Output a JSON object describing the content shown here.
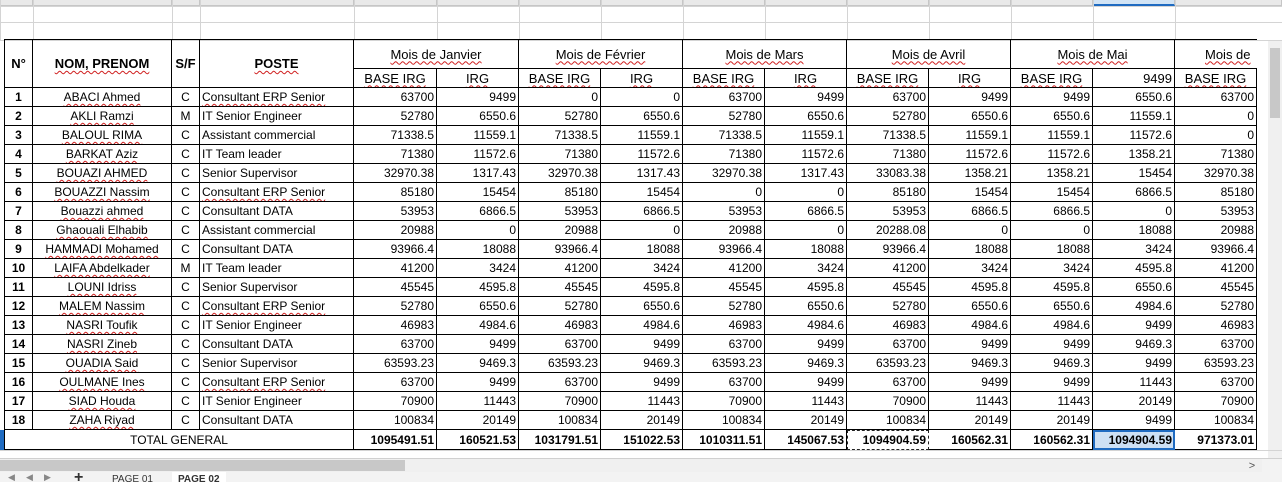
{
  "sheet": {
    "header_top": {
      "no": "N°",
      "name": "NOM, PRENOM",
      "sf": "S/F",
      "poste": "POSTE"
    },
    "months": [
      "Mois de Janvier",
      "Mois de Février",
      "Mois de Mars",
      "Mois de Avril",
      "Mois de Mai",
      "Mois de"
    ],
    "subheaders": [
      "BASE IRG",
      "IRG",
      "BASE IRG",
      "IRG",
      "BASE IRG",
      "IRG",
      "BASE IRG",
      "IRG",
      "BASE IRG",
      "9499",
      "BASE IRG"
    ],
    "rows": [
      {
        "no": "1",
        "name": "ABACI Ahmed",
        "sf": "C",
        "poste": "Consultant ERP  Senior",
        "v": [
          "63700",
          "9499",
          "0",
          "0",
          "63700",
          "9499",
          "63700",
          "9499",
          "9499",
          "6550.6",
          "63700"
        ]
      },
      {
        "no": "2",
        "name": "AKLI Ramzi",
        "sf": "M",
        "poste": "IT Senior  Engineer",
        "v": [
          "52780",
          "6550.6",
          "52780",
          "6550.6",
          "52780",
          "6550.6",
          "52780",
          "6550.6",
          "6550.6",
          "11559.1",
          "0"
        ]
      },
      {
        "no": "3",
        "name": "BALOUL RIMA",
        "sf": "C",
        "poste": "Assistant commercial",
        "v": [
          "71338.5",
          "11559.1",
          "71338.5",
          "11559.1",
          "71338.5",
          "11559.1",
          "71338.5",
          "11559.1",
          "11559.1",
          "11572.6",
          "0"
        ]
      },
      {
        "no": "4",
        "name": "BARKAT Aziz",
        "sf": "C",
        "poste": "IT Team leader",
        "v": [
          "71380",
          "11572.6",
          "71380",
          "11572.6",
          "71380",
          "11572.6",
          "71380",
          "11572.6",
          "11572.6",
          "1358.21",
          "71380"
        ]
      },
      {
        "no": "5",
        "name": "BOUAZI AHMED",
        "sf": "C",
        "poste": "Senior Supervisor",
        "v": [
          "32970.38",
          "1317.43",
          "32970.38",
          "1317.43",
          "32970.38",
          "1317.43",
          "33083.38",
          "1358.21",
          "1358.21",
          "15454",
          "32970.38"
        ]
      },
      {
        "no": "6",
        "name": "BOUAZZI Nassim",
        "sf": "C",
        "poste": "Consultant ERP  Senior",
        "v": [
          "85180",
          "15454",
          "85180",
          "15454",
          "0",
          "0",
          "85180",
          "15454",
          "15454",
          "6866.5",
          "85180"
        ]
      },
      {
        "no": "7",
        "name": "Bouazzi ahmed",
        "sf": "C",
        "poste": "Consultant DATA",
        "v": [
          "53953",
          "6866.5",
          "53953",
          "6866.5",
          "53953",
          "6866.5",
          "53953",
          "6866.5",
          "6866.5",
          "0",
          "53953"
        ]
      },
      {
        "no": "8",
        "name": "Ghaouali Elhabib",
        "sf": "C",
        "poste": "Assistant commercial",
        "v": [
          "20988",
          "0",
          "20988",
          "0",
          "20988",
          "0",
          "20288.08",
          "0",
          "0",
          "18088",
          "20988"
        ]
      },
      {
        "no": "9",
        "name": "HAMMADI Mohamed",
        "sf": "C",
        "poste": "Consultant DATA",
        "v": [
          "93966.4",
          "18088",
          "93966.4",
          "18088",
          "93966.4",
          "18088",
          "93966.4",
          "18088",
          "18088",
          "3424",
          "93966.4"
        ]
      },
      {
        "no": "10",
        "name": "LAIFA Abdelkader",
        "sf": "M",
        "poste": "IT Team leader",
        "v": [
          "41200",
          "3424",
          "41200",
          "3424",
          "41200",
          "3424",
          "41200",
          "3424",
          "3424",
          "4595.8",
          "41200"
        ]
      },
      {
        "no": "11",
        "name": "LOUNI Idriss",
        "sf": "C",
        "poste": "Senior Supervisor",
        "v": [
          "45545",
          "4595.8",
          "45545",
          "4595.8",
          "45545",
          "4595.8",
          "45545",
          "4595.8",
          "4595.8",
          "6550.6",
          "45545"
        ]
      },
      {
        "no": "12",
        "name": "MALEM Nassim",
        "sf": "C",
        "poste": "Consultant ERP  Senior",
        "v": [
          "52780",
          "6550.6",
          "52780",
          "6550.6",
          "52780",
          "6550.6",
          "52780",
          "6550.6",
          "6550.6",
          "4984.6",
          "52780"
        ]
      },
      {
        "no": "13",
        "name": "NASRI Toufik",
        "sf": "C",
        "poste": "IT Senior  Engineer",
        "v": [
          "46983",
          "4984.6",
          "46983",
          "4984.6",
          "46983",
          "4984.6",
          "46983",
          "4984.6",
          "4984.6",
          "9499",
          "46983"
        ]
      },
      {
        "no": "14",
        "name": "NASRI Zineb",
        "sf": "C",
        "poste": "Consultant DATA",
        "v": [
          "63700",
          "9499",
          "63700",
          "9499",
          "63700",
          "9499",
          "63700",
          "9499",
          "9499",
          "9469.3",
          "63700"
        ]
      },
      {
        "no": "15",
        "name": "OUADIA Said",
        "sf": "C",
        "poste": "Senior Supervisor",
        "v": [
          "63593.23",
          "9469.3",
          "63593.23",
          "9469.3",
          "63593.23",
          "9469.3",
          "63593.23",
          "9469.3",
          "9469.3",
          "9499",
          "63593.23"
        ]
      },
      {
        "no": "16",
        "name": "OULMANE Ines",
        "sf": "C",
        "poste": "Consultant ERP  Senior",
        "v": [
          "63700",
          "9499",
          "63700",
          "9499",
          "63700",
          "9499",
          "63700",
          "9499",
          "9499",
          "11443",
          "63700"
        ]
      },
      {
        "no": "17",
        "name": "SIAD Houda",
        "sf": "C",
        "poste": "IT Senior  Engineer",
        "v": [
          "70900",
          "11443",
          "70900",
          "11443",
          "70900",
          "11443",
          "70900",
          "11443",
          "11443",
          "20149",
          "70900"
        ]
      },
      {
        "no": "18",
        "name": "ZAHA Riyad",
        "sf": "C",
        "poste": "Consultant DATA",
        "v": [
          "100834",
          "20149",
          "100834",
          "20149",
          "100834",
          "20149",
          "100834",
          "20149",
          "20149",
          "9499",
          "100834"
        ]
      }
    ],
    "total": {
      "label": "TOTAL GENERAL",
      "v": [
        "1095491.51",
        "160521.53",
        "1031791.51",
        "151022.53",
        "1010311.51",
        "145067.53",
        "1094904.59",
        "160562.31",
        "160562.31",
        "1094904.59",
        "971373.01"
      ]
    }
  },
  "tabs": {
    "add": "+",
    "items": [
      "PAGE 01",
      "PAGE 02"
    ],
    "active": 1
  },
  "scroll": {
    "right_arrow": ">"
  }
}
